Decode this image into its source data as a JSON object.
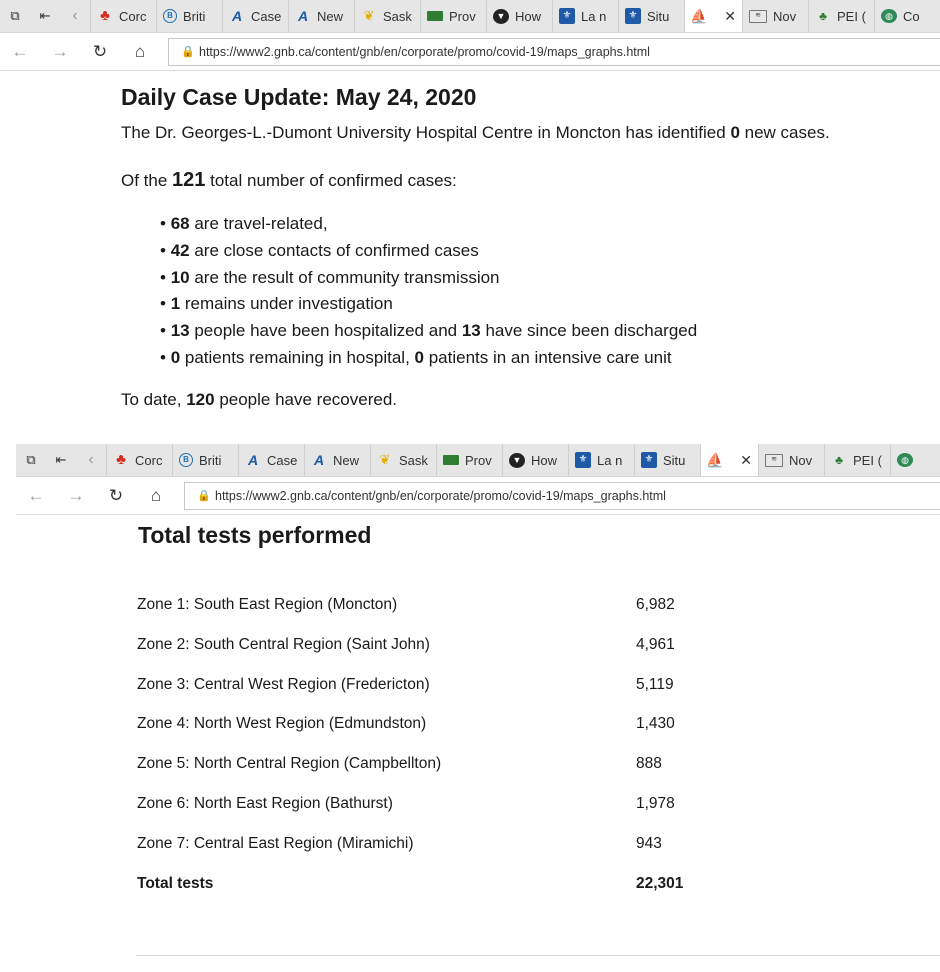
{
  "browser": {
    "tabs": [
      {
        "icon": "canada-leaf-icon",
        "label": "Corc"
      },
      {
        "icon": "bc-icon",
        "label": "Briti"
      },
      {
        "icon": "nb-icon",
        "label": "Case"
      },
      {
        "icon": "nb-icon",
        "label": "New"
      },
      {
        "icon": "sask-icon",
        "label": "Sask"
      },
      {
        "icon": "prov-icon",
        "label": "Prov"
      },
      {
        "icon": "how-icon",
        "label": "How"
      },
      {
        "icon": "quebec-icon",
        "label": "La n"
      },
      {
        "icon": "quebec-icon",
        "label": "Situ"
      }
    ],
    "tabs_after": [
      {
        "icon": "nov-icon",
        "label": "Nov"
      },
      {
        "icon": "pei-icon",
        "label": "PEI ("
      },
      {
        "icon": "globe-icon",
        "label": "Co"
      }
    ],
    "url": "https://www2.gnb.ca/content/gnb/en/corporate/promo/covid-19/maps_graphs.html"
  },
  "update": {
    "title": "Daily Case Update: May 24, 2020",
    "intro_pre": "The Dr. Georges-L.-Dumont University Hospital Centre in Moncton has identified ",
    "intro_num": "0",
    "intro_post": " new cases.",
    "total_pre": "Of the ",
    "total_num": "121",
    "total_post": " total number of confirmed cases:",
    "bullets": [
      {
        "n1": "68",
        "t1": " are travel-related,"
      },
      {
        "n1": "42",
        "t1": " are close contacts of confirmed cases"
      },
      {
        "n1": "10",
        "t1": " are the result of community transmission"
      },
      {
        "n1": "1",
        "t1": " remains under investigation"
      },
      {
        "n1": "13",
        "t1": " people have been hospitalized and ",
        "n2": "13",
        "t2": " have since been discharged"
      },
      {
        "n1": "0",
        "t1": " patients remaining in hospital, ",
        "n2": "0",
        "t2": " patients in an intensive care unit"
      }
    ],
    "recovered_pre": "To date, ",
    "recovered_num": "120",
    "recovered_post": " people have recovered."
  },
  "tests": {
    "title": "Total tests performed",
    "rows": [
      {
        "zone": "Zone 1: South East Region (Moncton)",
        "value": "6,982"
      },
      {
        "zone": "Zone 2: South Central Region (Saint John)",
        "value": "4,961"
      },
      {
        "zone": "Zone 3: Central West Region (Fredericton)",
        "value": "5,119"
      },
      {
        "zone": "Zone 4: North West Region (Edmundston)",
        "value": "1,430"
      },
      {
        "zone": "Zone 5: North Central Region (Campbellton)",
        "value": "888"
      },
      {
        "zone": "Zone 6: North East Region (Bathurst)",
        "value": "1,978"
      },
      {
        "zone": "Zone 7: Central East Region (Miramichi)",
        "value": "943"
      }
    ],
    "total_label": "Total tests",
    "total_value": "22,301"
  }
}
